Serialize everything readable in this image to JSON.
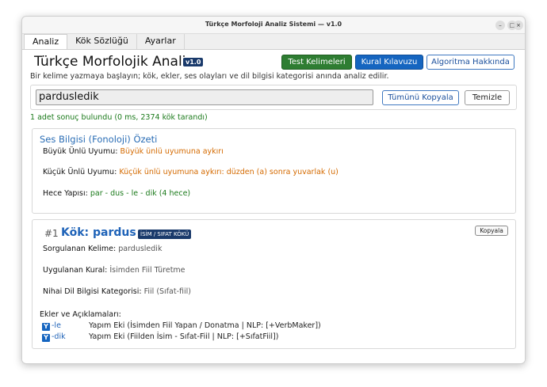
{
  "window": {
    "title": "Türkçe Morfoloji Analiz Sistemi — v1.0",
    "controls": [
      "–",
      "□",
      "×"
    ]
  },
  "tabs": [
    {
      "label": "Analiz",
      "active": true
    },
    {
      "label": "Kök Sözlüğü",
      "active": false
    },
    {
      "label": "Ayarlar",
      "active": false
    }
  ],
  "header": {
    "title": "Türkçe Morfolojik Analiz",
    "version": "v1.0",
    "subtitle": "Bir kelime yazmaya başlayın; kök, ekler, ses olayları ve dil bilgisi kategorisi anında analiz edilir.",
    "buttons": {
      "test": "Test Kelimeleri",
      "guide": "Kural Kılavuzu",
      "about": "Algoritma Hakkında"
    }
  },
  "search": {
    "value": "pardusledik",
    "copy_all": "Tümünü Kopyala",
    "clear": "Temizle"
  },
  "result_count": "1 adet sonuç bulundu (0 ms, 2374 kök tarandı)",
  "phonology": {
    "title": "Ses Bilgisi (Fonoloji) Özeti",
    "major_label": "Büyük Ünlü Uyumu:",
    "major_value": "Büyük ünlü uyumuna aykırı",
    "minor_label": "Küçük Ünlü Uyumu:",
    "minor_value": "Küçük ünlü uyumuna aykırı: düzden (a) sonra yuvarlak (u)",
    "syllable_label": "Hece Yapısı:",
    "syllable_value": "par - dus - le - dik  (4 hece)"
  },
  "result": {
    "number": "#1",
    "root_title": "Kök: pardus",
    "badge": "İSİM / SIFAT KÖKÜ",
    "copy": "Kopyala",
    "queried_label": "Sorgulanan Kelime:",
    "queried_value": "pardusledik",
    "rule_label": "Uygulanan Kural:",
    "rule_value": "İsimden Fiil Türetme",
    "category_label": "Nihai Dil Bilgisi Kategorisi:",
    "category_value": "Fiil (Sıfat-fiil)",
    "suffixes_title": "Ekler ve Açıklamaları:",
    "suffixes": [
      {
        "icon": "Y",
        "name": "-le",
        "desc": "Yapım Eki (İsimden Fiil Yapan / Donatma | NLP: [+VerbMaker])"
      },
      {
        "icon": "Y",
        "name": "-dik",
        "desc": "Yapım Eki (Fiilden İsim - Sıfat-Fiil | NLP: [+SıfatFiil])"
      }
    ]
  }
}
